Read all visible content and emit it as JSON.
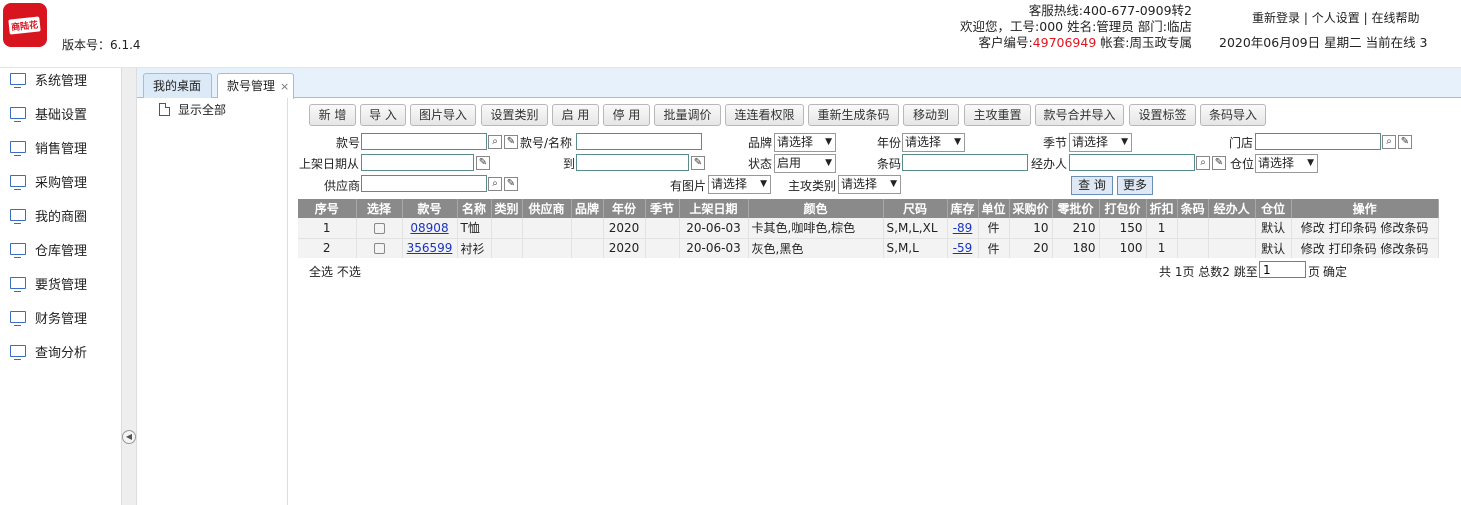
{
  "header": {
    "logo_text": "商陆花",
    "version": "版本号：6.1.4",
    "hotline": "客服热线:400-677-0909转2",
    "welcome": "欢迎您，工号:000 姓名:管理员 部门:临店",
    "customer_label": "客户编号:",
    "customer_no": "49706949",
    "account": "帐套:周玉政专属",
    "links": [
      "重新登录",
      "个人设置",
      "在线帮助"
    ],
    "separator": "|",
    "date_line": "2020年06月09日 星期二 当前在线 3"
  },
  "sidebar": {
    "items": [
      "系统管理",
      "基础设置",
      "销售管理",
      "采购管理",
      "我的商圈",
      "仓库管理",
      "要货管理",
      "财务管理",
      "查询分析"
    ]
  },
  "tabs": [
    {
      "label": "我的桌面"
    },
    {
      "label": "款号管理",
      "close": "×"
    }
  ],
  "tree": {
    "root": "显示全部"
  },
  "toolbar": [
    "新 增",
    "导 入",
    "图片导入",
    "设置类别",
    "启 用",
    "停 用",
    "批量调价",
    "连连看权限",
    "重新生成条码",
    "移动到",
    "主攻重置",
    "款号合并导入",
    "设置标签",
    "条码导入"
  ],
  "filters": {
    "style_no": "款号",
    "style_name": "款号/名称",
    "brand": "品牌",
    "year": "年份",
    "season": "季节",
    "store": "门店",
    "shelf_from": "上架日期从",
    "to": "到",
    "status": "状态",
    "barcode": "条码",
    "handler": "经办人",
    "warehouse": "仓位",
    "supplier": "供应商",
    "has_image": "有图片",
    "main_cat": "主攻类别",
    "placeholder_select": "请选择",
    "status_value": "启用",
    "query": "查 询",
    "more": "更多"
  },
  "table": {
    "columns": [
      "序号",
      "选择",
      "款号",
      "名称",
      "类别",
      "供应商",
      "品牌",
      "年份",
      "季节",
      "上架日期",
      "颜色",
      "尺码",
      "库存",
      "单位",
      "采购价",
      "零批价",
      "打包价",
      "折扣",
      "条码",
      "经办人",
      "仓位",
      "操作"
    ],
    "rows": [
      {
        "idx": "1",
        "code": "08908",
        "name": "T恤",
        "category": "",
        "supplier": "",
        "brand": "",
        "year": "2020",
        "season": "",
        "date": "20-06-03",
        "colors": "卡其色,咖啡色,棕色",
        "sizes": "S,M,L,XL",
        "stock": "-89",
        "unit": "件",
        "purchase": "10",
        "wholesale": "210",
        "pack": "150",
        "discount": "1",
        "barcode": "",
        "handler": "",
        "warehouse": "默认",
        "ops": [
          "修改",
          "打印条码",
          "修改条码"
        ]
      },
      {
        "idx": "2",
        "code": "356599",
        "name": "衬衫",
        "category": "",
        "supplier": "",
        "brand": "",
        "year": "2020",
        "season": "",
        "date": "20-06-03",
        "colors": "灰色,黑色",
        "sizes": "S,M,L",
        "stock": "-59",
        "unit": "件",
        "purchase": "20",
        "wholesale": "180",
        "pack": "100",
        "discount": "1",
        "barcode": "",
        "handler": "",
        "warehouse": "默认",
        "ops": [
          "修改",
          "打印条码",
          "修改条码"
        ]
      }
    ]
  },
  "footer": {
    "select_all": "全选",
    "select_none": "不选",
    "pages": "共 1页 总数2 跳至",
    "page_value": "1",
    "page_unit": "页",
    "confirm": "确定"
  }
}
